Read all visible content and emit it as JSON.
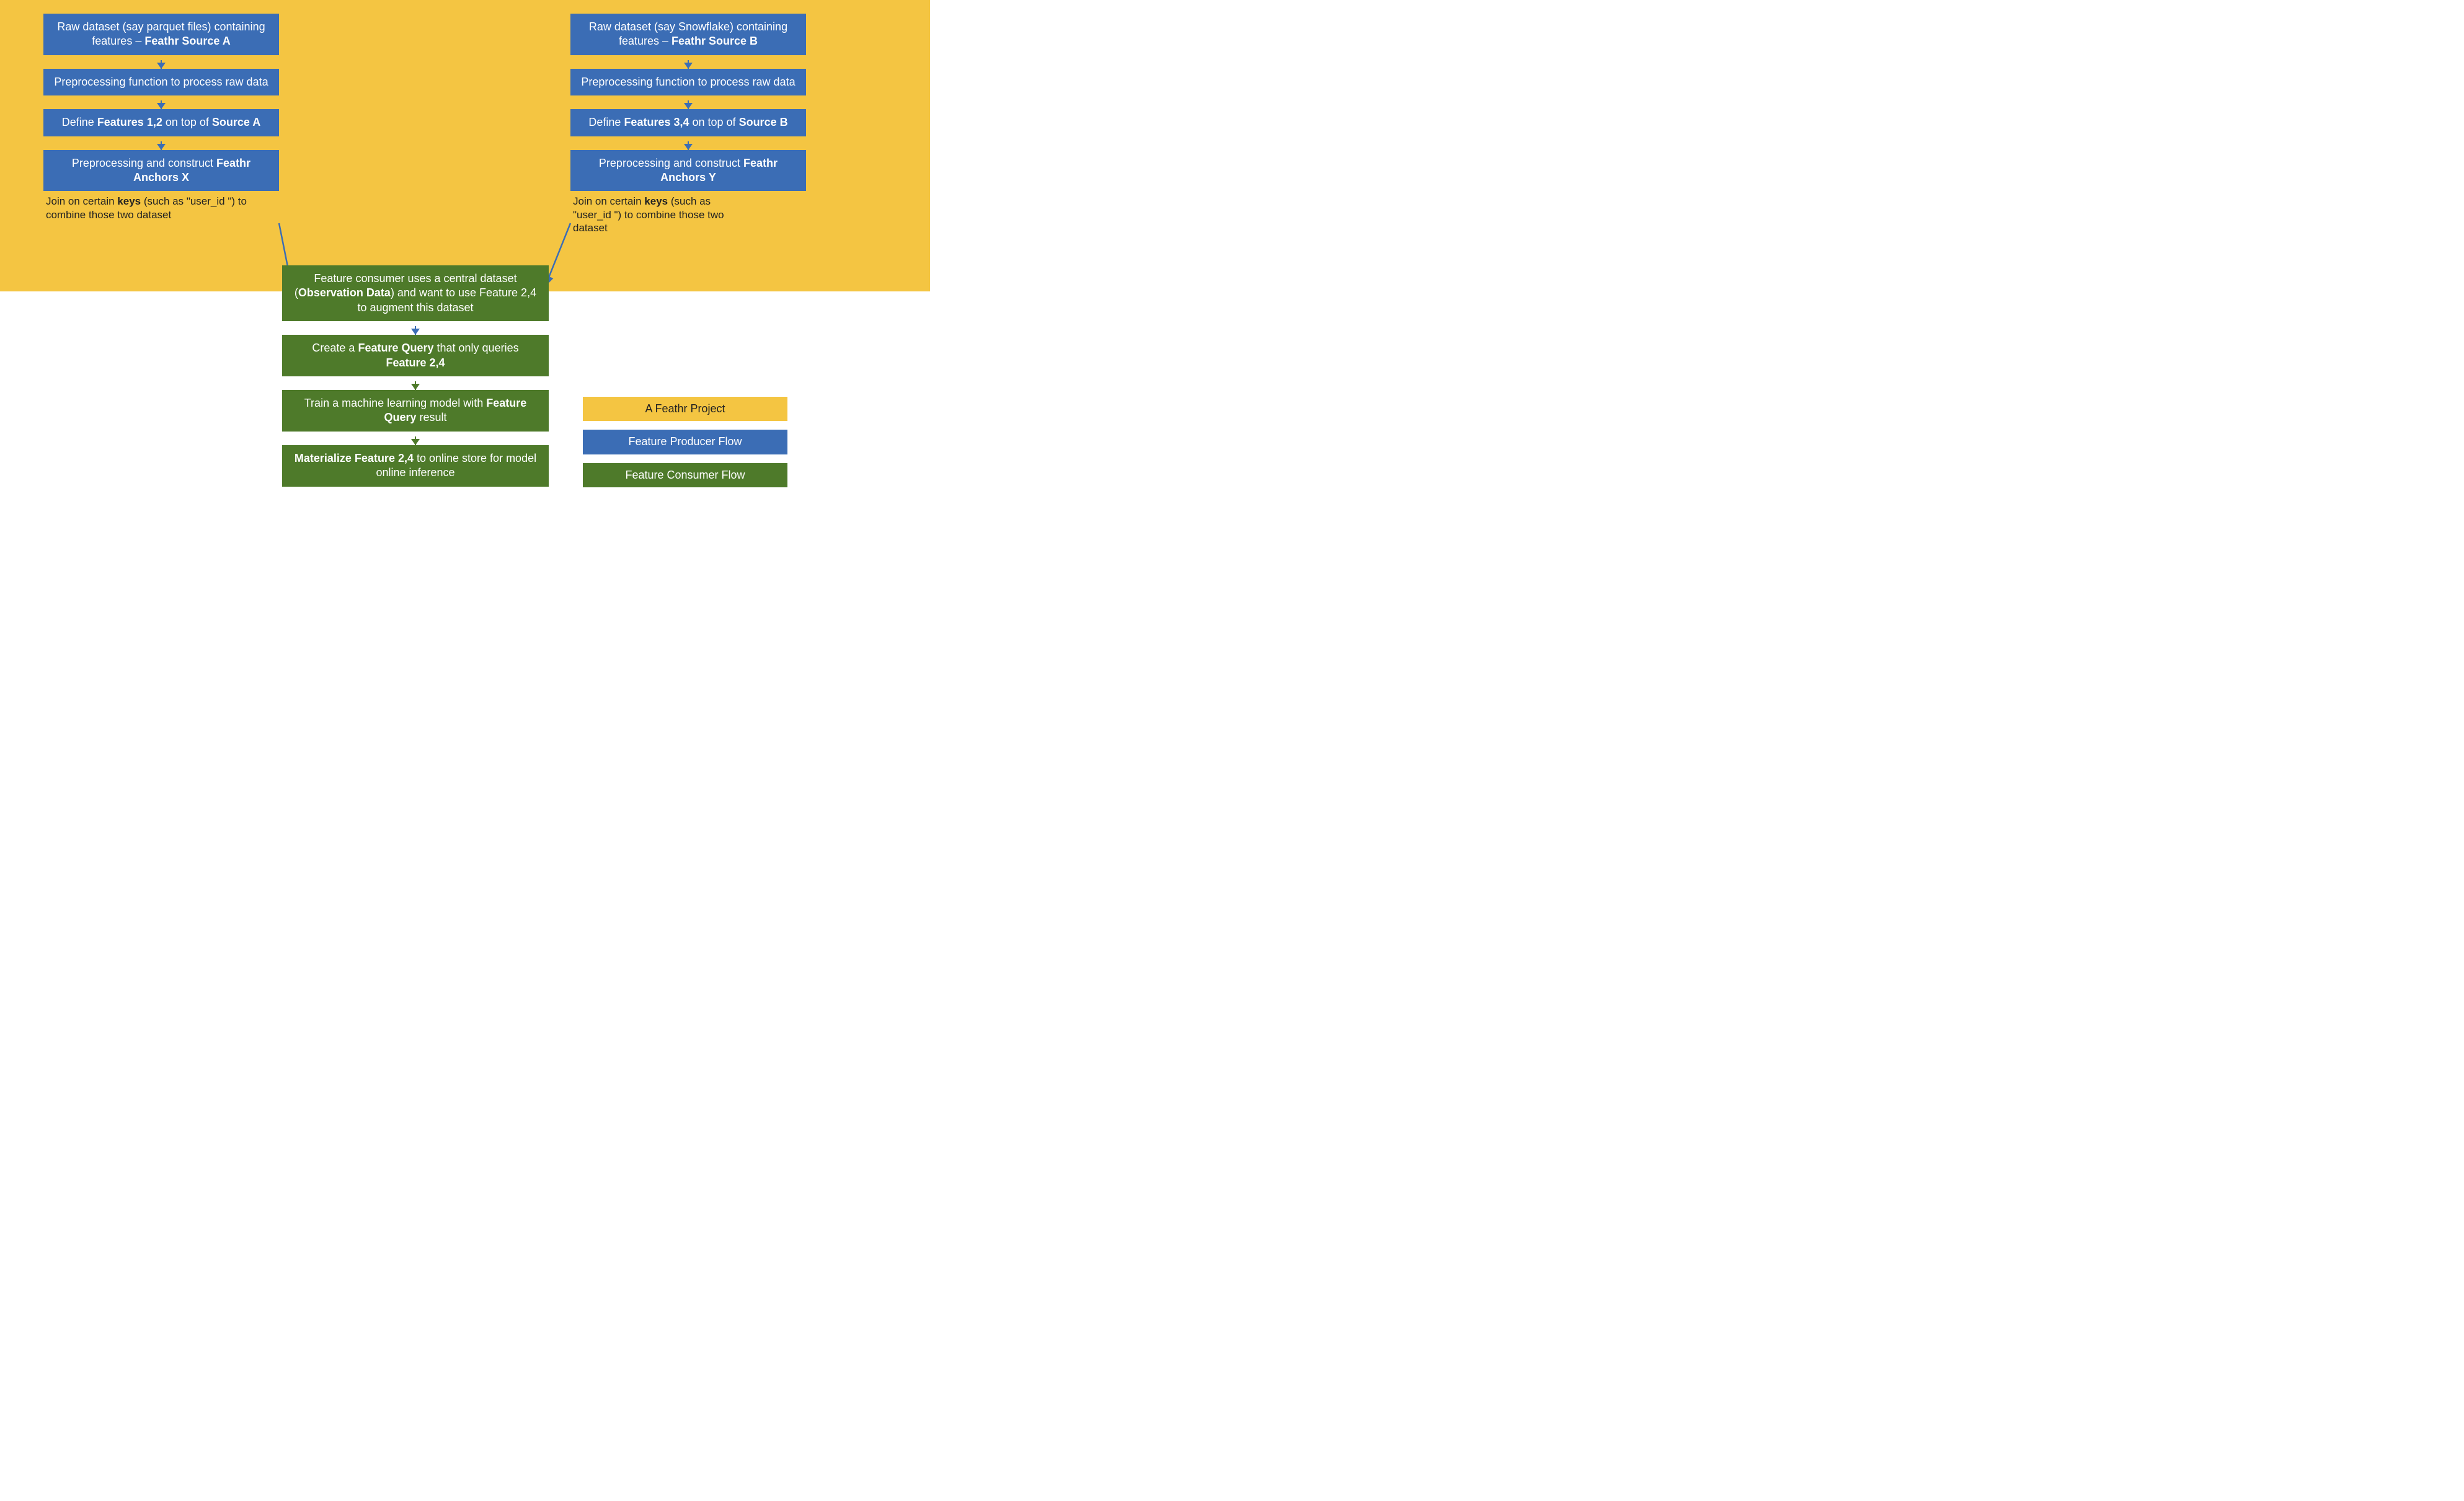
{
  "colA": {
    "box1_pre": "Raw dataset (say parquet files) containing features – ",
    "box1_bold": "Feathr Source A",
    "box2": "Preprocessing function to process raw data",
    "box3_a": "Define ",
    "box3_b": "Features 1,2 ",
    "box3_c": "on top of ",
    "box3_d": "Source A",
    "box4_a": "Preprocessing and construct ",
    "box4_b": "Feathr Anchors X",
    "cap_a": "Join on certain ",
    "cap_b": "keys ",
    "cap_c": "(such as \"user_id \") to combine those two dataset"
  },
  "colB": {
    "box1_pre": "Raw dataset (say Snowflake) containing features – ",
    "box1_bold": "Feathr Source B",
    "box2": "Preprocessing function to process raw data",
    "box3_a": "Define ",
    "box3_b": "Features 3,4 ",
    "box3_c": "on top of ",
    "box3_d": "Source B",
    "box4_a": "Preprocessing and construct ",
    "box4_b": "Feathr Anchors Y",
    "cap_a": "Join on certain ",
    "cap_b": "keys ",
    "cap_c": "(such as \"user_id \") to combine those two dataset"
  },
  "colC": {
    "box1_a": "Feature consumer uses a central dataset (",
    "box1_b": "Observation Data",
    "box1_c": ") and want to use Feature 2,4 to augment this dataset",
    "box2_a": "Create a ",
    "box2_b": "Feature Query ",
    "box2_c": "that only queries ",
    "box2_d": "Feature 2,4",
    "box3_a": "Train a machine learning model with ",
    "box3_b": "Feature Query ",
    "box3_c": "result",
    "box4_a": "Materialize Feature 2,4 ",
    "box4_b": "to online store for model online inference"
  },
  "legend": {
    "l1": "A Feathr Project",
    "l2": "Feature Producer Flow",
    "l3": "Feature Consumer Flow"
  }
}
